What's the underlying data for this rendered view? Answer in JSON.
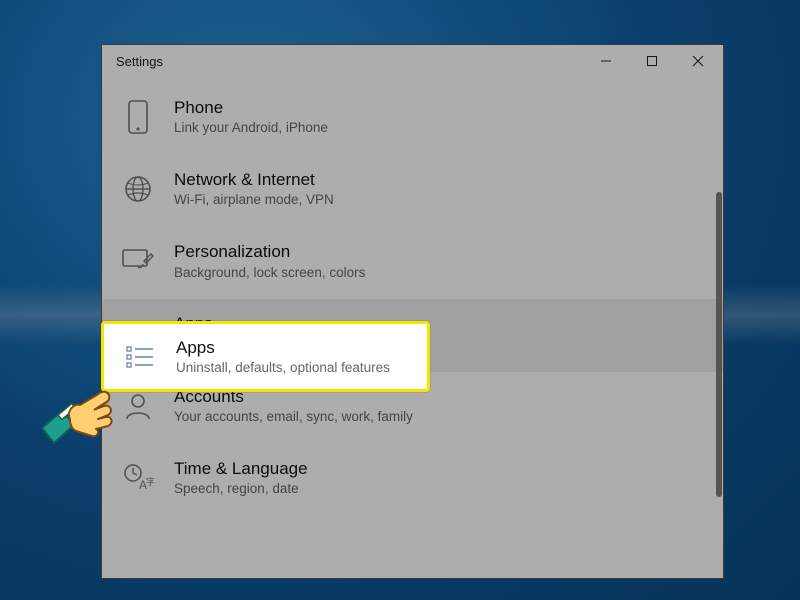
{
  "window": {
    "title": "Settings"
  },
  "items": [
    {
      "title": "Phone",
      "subtitle": "Link your Android, iPhone"
    },
    {
      "title": "Network & Internet",
      "subtitle": "Wi-Fi, airplane mode, VPN"
    },
    {
      "title": "Personalization",
      "subtitle": "Background, lock screen, colors"
    },
    {
      "title": "Apps",
      "subtitle": "Uninstall, defaults, optional features"
    },
    {
      "title": "Accounts",
      "subtitle": "Your accounts, email, sync, work, family"
    },
    {
      "title": "Time & Language",
      "subtitle": "Speech, region, date"
    }
  ],
  "highlight": {
    "title": "Apps",
    "subtitle": "Uninstall, defaults, optional features"
  }
}
